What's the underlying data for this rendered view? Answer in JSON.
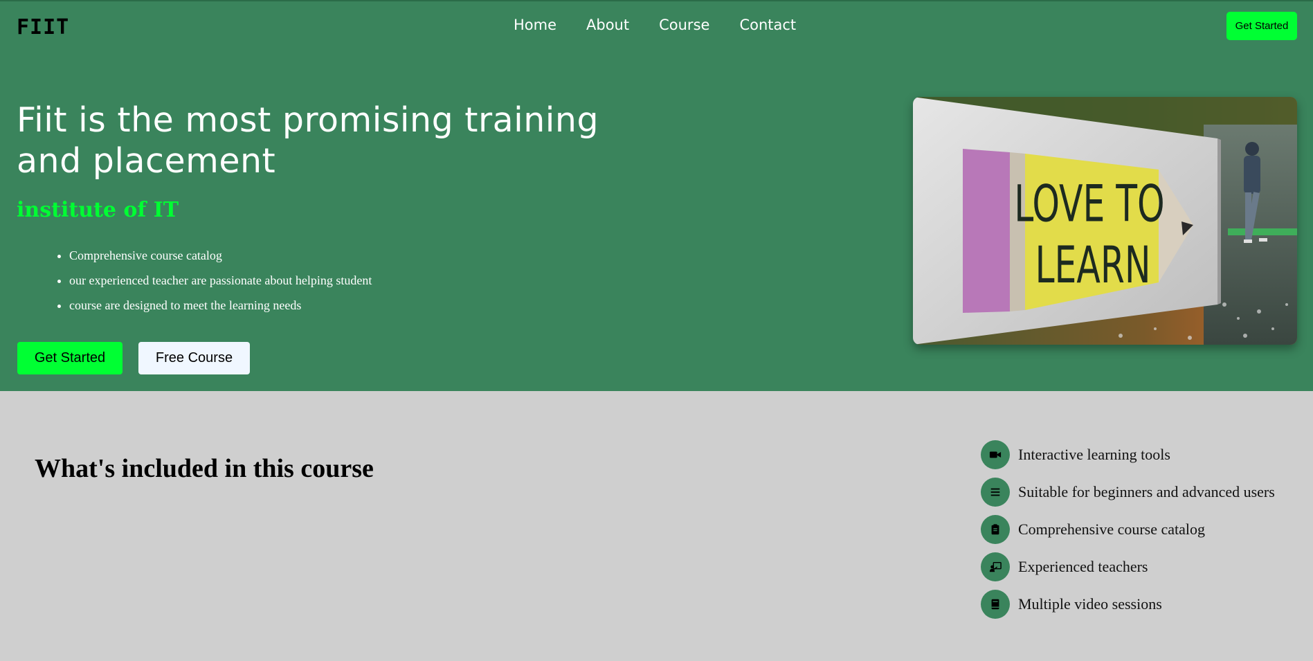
{
  "brand": {
    "logo": "FIIT"
  },
  "nav": {
    "items": [
      "Home",
      "About",
      "Course",
      "Contact"
    ],
    "cta": "Get Started"
  },
  "hero": {
    "title": "Fiit is the most promising training and placement",
    "subtitle": "institute of IT",
    "bullets": [
      "Comprehensive course catalog",
      "our experienced teacher are passionate about helping student",
      "course are designed to meet the learning needs"
    ],
    "primary_button": "Get Started",
    "secondary_button": "Free Course",
    "image_text_line1": "LOVE TO",
    "image_text_line2": "LEARN"
  },
  "features_section": {
    "title": "What's included in this course",
    "items": [
      {
        "icon": "video-icon",
        "label": "Interactive learning tools"
      },
      {
        "icon": "list-icon",
        "label": "Suitable for beginners and advanced users"
      },
      {
        "icon": "clipboard-icon",
        "label": "Comprehensive course catalog"
      },
      {
        "icon": "teacher-icon",
        "label": "Experienced teachers"
      },
      {
        "icon": "book-icon",
        "label": "Multiple video sessions"
      }
    ]
  },
  "colors": {
    "hero_bg": "#3a845c",
    "accent": "#00ff33",
    "section_bg": "#cfcfcf"
  }
}
